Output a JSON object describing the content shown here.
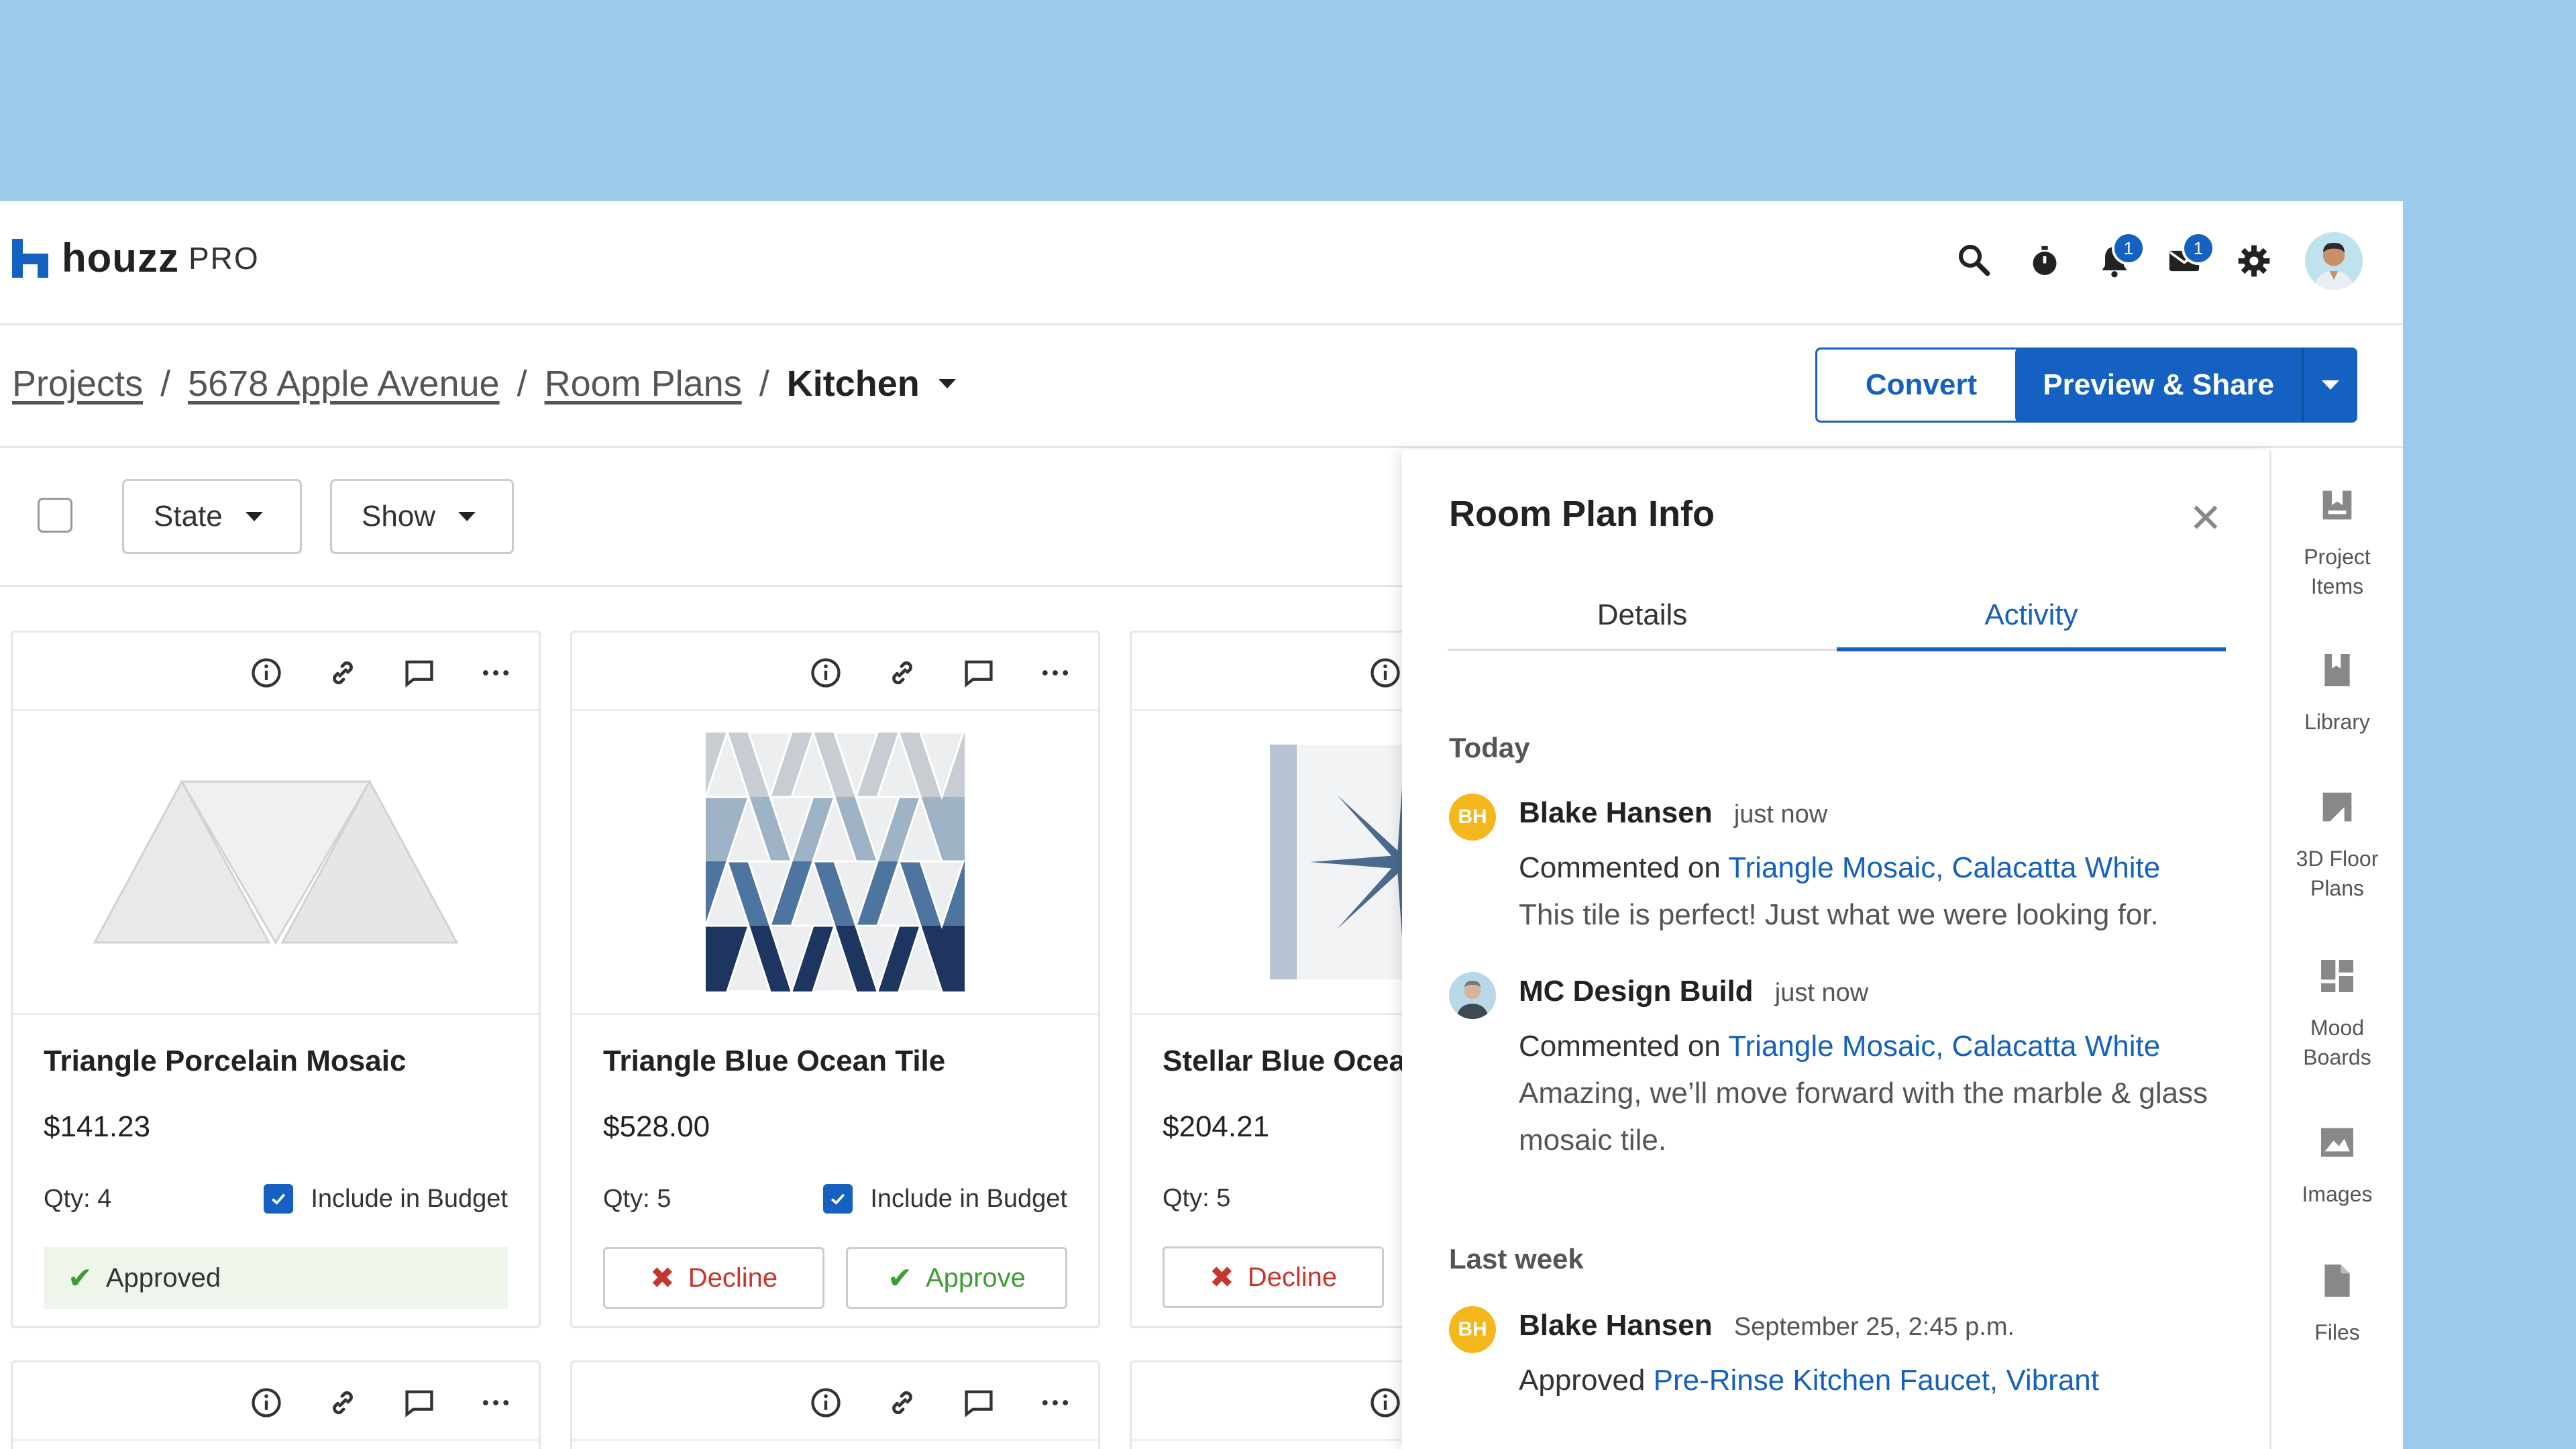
{
  "app": {
    "brand": "houzz",
    "tier": "PRO"
  },
  "topbar": {
    "notifications_count": "1",
    "messages_count": "1",
    "icons": [
      "search-icon",
      "timer-icon",
      "bell-icon",
      "mail-icon",
      "gear-icon",
      "avatar"
    ]
  },
  "breadcrumb": {
    "items": [
      "Projects",
      "5678 Apple Avenue",
      "Room Plans"
    ],
    "separator": "/",
    "current": "Kitchen"
  },
  "actions": {
    "convert": "Convert",
    "preview_share": "Preview & Share"
  },
  "filters": {
    "state": "State",
    "show": "Show"
  },
  "cards": [
    {
      "title": "Triangle Porcelain Mosaic",
      "price": "$141.23",
      "qty": "Qty: 4",
      "include_label": "Include in Budget",
      "status": "Approved"
    },
    {
      "title": "Triangle Blue Ocean Tile",
      "price": "$528.00",
      "qty": "Qty: 5",
      "include_label": "Include in Budget",
      "decline": "Decline",
      "approve": "Approve"
    },
    {
      "title": "Stellar Blue Ocean",
      "price": "$204.21",
      "qty": "Qty: 5",
      "decline": "Decline"
    }
  ],
  "panel": {
    "title": "Room Plan Info",
    "tabs": [
      "Details",
      "Activity"
    ],
    "active_tab": "Activity",
    "sections": {
      "today": "Today",
      "last_week": "Last week"
    },
    "activity": [
      {
        "initials": "BH",
        "name": "Blake Hansen",
        "when": "just now",
        "action": "Commented on",
        "item": "Triangle Mosaic, Calacatta White",
        "note": "This tile is perfect! Just what we were looking for."
      },
      {
        "name": "MC Design Build",
        "when": "just now",
        "action": "Commented on",
        "item": "Triangle Mosaic, Calacatta White",
        "note": "Amazing, we’ll move forward with the marble & glass mosaic tile."
      },
      {
        "initials": "BH",
        "name": "Blake Hansen",
        "when": "September 25, 2:45 p.m.",
        "action": "Approved",
        "item": "Pre-Rinse Kitchen Faucet, Vibrant"
      }
    ]
  },
  "rail": [
    {
      "label_1": "Project",
      "label_2": "Items",
      "icon": "project-items-icon"
    },
    {
      "label_1": "Library",
      "icon": "library-icon"
    },
    {
      "label_1": "3D Floor",
      "label_2": "Plans",
      "icon": "floor-plans-icon"
    },
    {
      "label_1": "Mood",
      "label_2": "Boards",
      "icon": "mood-boards-icon"
    },
    {
      "label_1": "Images",
      "icon": "images-icon"
    },
    {
      "label_1": "Files",
      "icon": "files-icon"
    }
  ],
  "colors": {
    "accent": "#1461c1",
    "background": "#9dc9eb",
    "approve": "#3e9c35",
    "decline": "#c9352b",
    "avatar_bh": "#f6b71c"
  }
}
